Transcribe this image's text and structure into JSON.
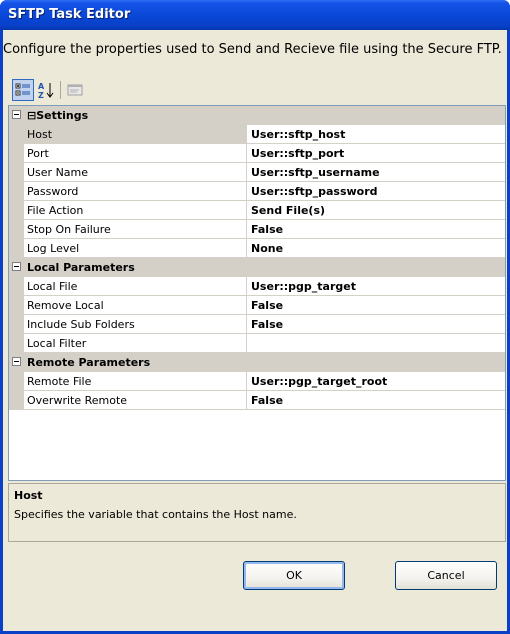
{
  "window": {
    "title": "SFTP Task Editor"
  },
  "description": "Configure the properties used to Send and Recieve file using the Secure FTP.",
  "toolbar": {
    "categorized": "categorized-icon",
    "alphabetical": "sort-alpha-icon",
    "property_pages": "property-pages-icon"
  },
  "categories": [
    {
      "label": "Settings",
      "properties": [
        {
          "name": "Host",
          "value": "User::sftp_host"
        },
        {
          "name": "Port",
          "value": "User::sftp_port"
        },
        {
          "name": "User Name",
          "value": "User::sftp_username"
        },
        {
          "name": "Password",
          "value": "User::sftp_password"
        },
        {
          "name": "File Action",
          "value": "Send File(s)"
        },
        {
          "name": "Stop On Failure",
          "value": "False"
        },
        {
          "name": "Log Level",
          "value": "None"
        }
      ]
    },
    {
      "label": "Local Parameters",
      "properties": [
        {
          "name": "Local File",
          "value": "User::pgp_target"
        },
        {
          "name": "Remove Local",
          "value": "False"
        },
        {
          "name": "Include Sub Folders",
          "value": "False"
        },
        {
          "name": "Local Filter",
          "value": ""
        }
      ]
    },
    {
      "label": "Remote Parameters",
      "properties": [
        {
          "name": "Remote File",
          "value": "User::pgp_target_root"
        },
        {
          "name": "Overwrite Remote",
          "value": "False"
        }
      ]
    }
  ],
  "help": {
    "title": "Host",
    "text": "Specifies the variable that contains the Host name."
  },
  "buttons": {
    "ok": "OK",
    "cancel": "Cancel"
  },
  "colors": {
    "titlebar": "#0a48d8",
    "dialog": "#ece9d8",
    "category": "#d4d0c8"
  }
}
